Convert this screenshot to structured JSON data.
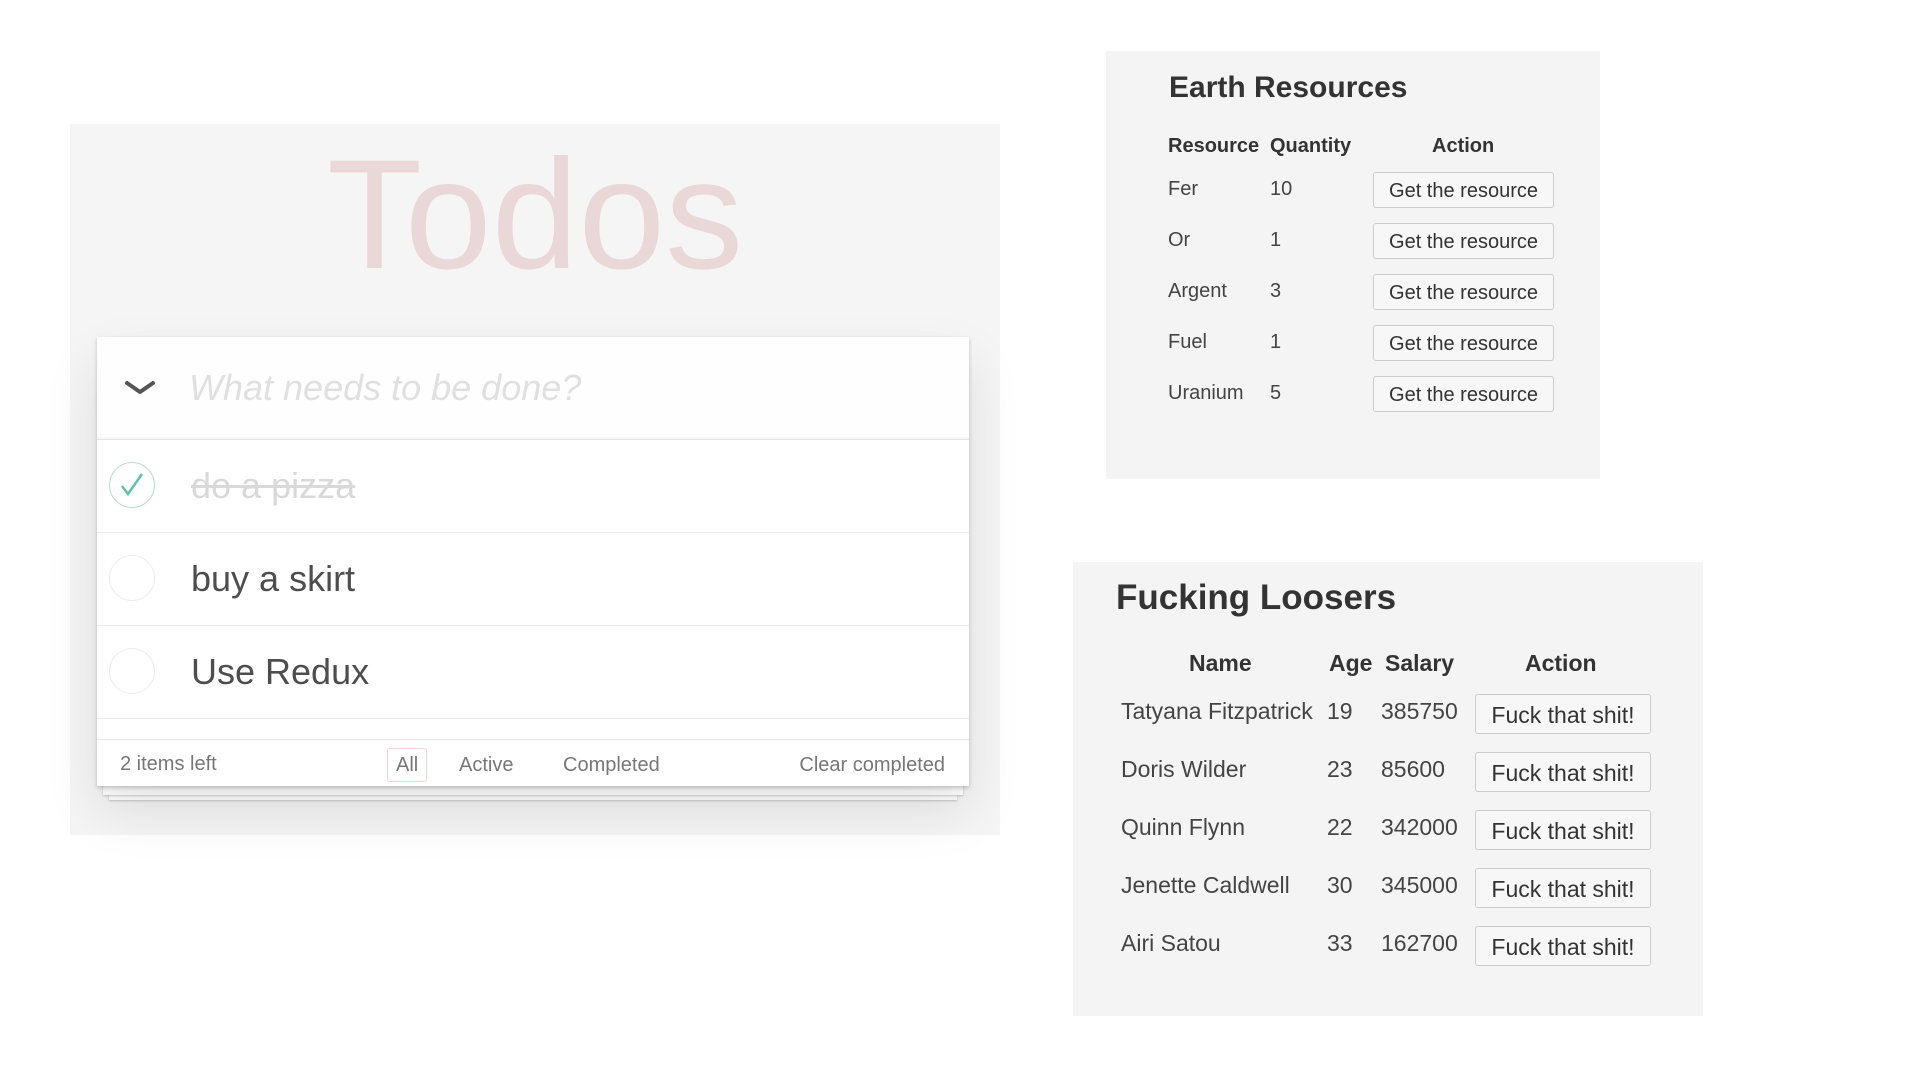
{
  "todo": {
    "title": "Todos",
    "new_todo_placeholder": "What needs to be done?",
    "items": [
      {
        "label": "do a pizza",
        "completed": true
      },
      {
        "label": "buy a skirt",
        "completed": false
      },
      {
        "label": "Use Redux",
        "completed": false
      }
    ],
    "footer": {
      "count_label": "2 items left",
      "filters": [
        "All",
        "Active",
        "Completed"
      ],
      "selected_filter": "All",
      "clear_label": "Clear completed"
    }
  },
  "earth": {
    "title": "Earth Resources",
    "headers": [
      "Resource",
      "Quantity",
      "Action"
    ],
    "rows": [
      {
        "resource": "Fer",
        "quantity": "10",
        "action": "Get the resource"
      },
      {
        "resource": "Or",
        "quantity": "1",
        "action": "Get the resource"
      },
      {
        "resource": "Argent",
        "quantity": "3",
        "action": "Get the resource"
      },
      {
        "resource": "Fuel",
        "quantity": "1",
        "action": "Get the resource"
      },
      {
        "resource": "Uranium",
        "quantity": "5",
        "action": "Get the resource"
      }
    ]
  },
  "loosers": {
    "title": "Fucking Loosers",
    "headers": [
      "Name",
      "Age",
      "Salary",
      "Action"
    ],
    "rows": [
      {
        "name": "Tatyana Fitzpatrick",
        "age": "19",
        "salary": "385750",
        "action": "Fuck that shit!"
      },
      {
        "name": "Doris Wilder",
        "age": "23",
        "salary": "85600",
        "action": "Fuck that shit!"
      },
      {
        "name": "Quinn Flynn",
        "age": "22",
        "salary": "342000",
        "action": "Fuck that shit!"
      },
      {
        "name": "Jenette Caldwell",
        "age": "30",
        "salary": "345000",
        "action": "Fuck that shit!"
      },
      {
        "name": "Airi Satou",
        "age": "33",
        "salary": "162700",
        "action": "Fuck that shit!"
      }
    ]
  },
  "colors": {
    "todo_title": "#e6d3d3",
    "check_green": "#5dc2af",
    "panel_bg": "#f4f4f4"
  }
}
